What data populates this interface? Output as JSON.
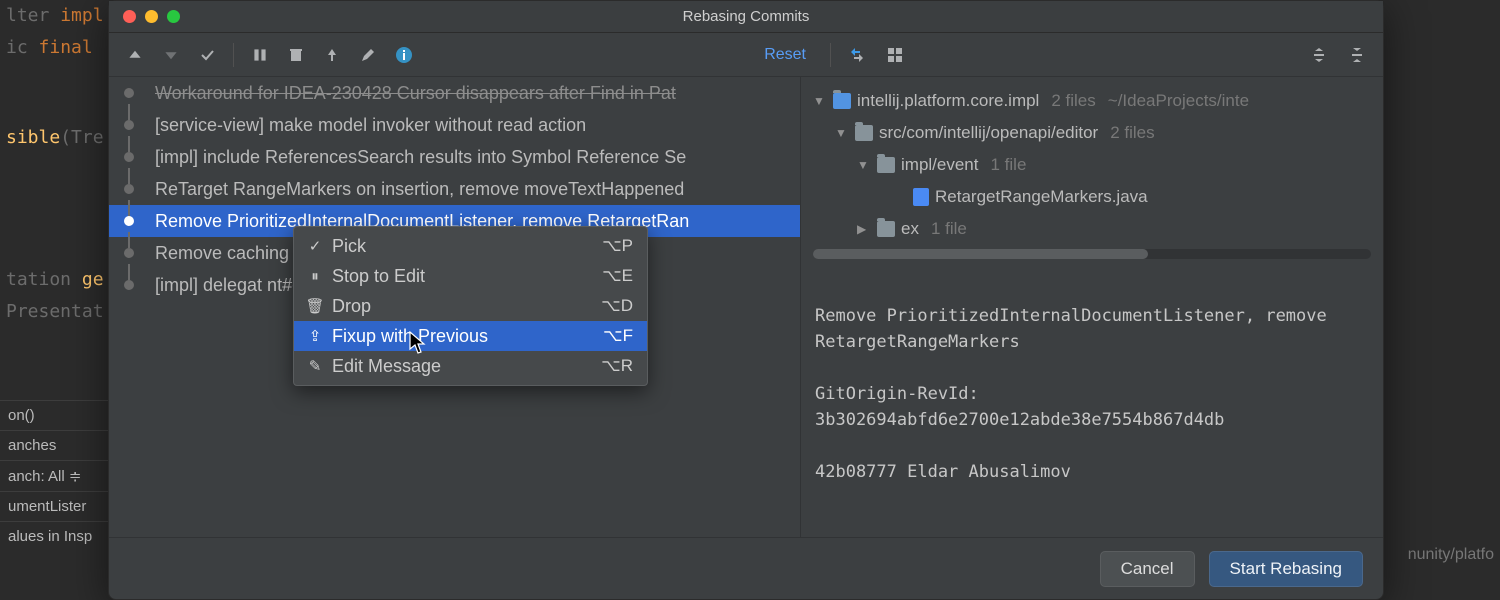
{
  "bg": {
    "line1_pre": "lter ",
    "line1_kw": "impl",
    "line2_pre": "ic ",
    "line2_kw": "final",
    "line4_id": "sible",
    "line4_after": "(Tre",
    "line7_pre": "tation ",
    "line7_id": "ge",
    "line8": "Presentat",
    "panel_items": [
      "on()",
      "anches",
      "anch: All ≑",
      "umentLister",
      "alues in Insp"
    ],
    "right_text": "nunity/platfo"
  },
  "window": {
    "title": "Rebasing Commits"
  },
  "toolbar": {
    "reset": "Reset"
  },
  "commits": [
    {
      "msg": "Workaround for IDEA-230428 Cursor disappears after Find in Pat",
      "striked": true
    },
    {
      "msg": "[service-view] make model invoker without read action"
    },
    {
      "msg": "[impl] include ReferencesSearch results into Symbol Reference Se"
    },
    {
      "msg": "ReTarget RangeMarkers on insertion, remove moveTextHappened "
    },
    {
      "msg": "Remove PrioritizedInternalDocumentListener, remove RetargetRan",
      "selected": true
    },
    {
      "msg": "Remove caching                                                   (IDEA-CR-575"
    },
    {
      "msg": "[impl] delegat                                                      nt#getOwnRefe"
    }
  ],
  "ctx": {
    "items": [
      {
        "icon": "✓",
        "label": "Pick",
        "shortcut": "⌥P"
      },
      {
        "icon": "⏸",
        "label": "Stop to Edit",
        "shortcut": "⌥E"
      },
      {
        "icon": "🗑",
        "label": "Drop",
        "shortcut": "⌥D"
      },
      {
        "icon": "⇪",
        "label": "Fixup with Previous",
        "shortcut": "⌥F",
        "selected": true
      },
      {
        "icon": "✎",
        "label": "Edit Message",
        "shortcut": "⌥R"
      }
    ]
  },
  "tree": {
    "root": {
      "name": "intellij.platform.core.impl",
      "files": "2 files",
      "path": "~/IdeaProjects/inte"
    },
    "l1": {
      "name": "src/com/intellij/openapi/editor",
      "files": "2 files"
    },
    "l2a": {
      "name": "impl/event",
      "files": "1 file"
    },
    "file": {
      "name": "RetargetRangeMarkers.java"
    },
    "l2b": {
      "name": "ex",
      "files": "1 file"
    }
  },
  "details": {
    "subject": "Remove PrioritizedInternalDocumentListener, remove RetargetRangeMarkers",
    "origin_label": "GitOrigin-RevId:",
    "origin_value": "3b302694abfd6e2700e12abde38e7554b867d4db",
    "author_line": "42b08777 Eldar Abusalimov"
  },
  "footer": {
    "cancel": "Cancel",
    "start": "Start Rebasing"
  }
}
